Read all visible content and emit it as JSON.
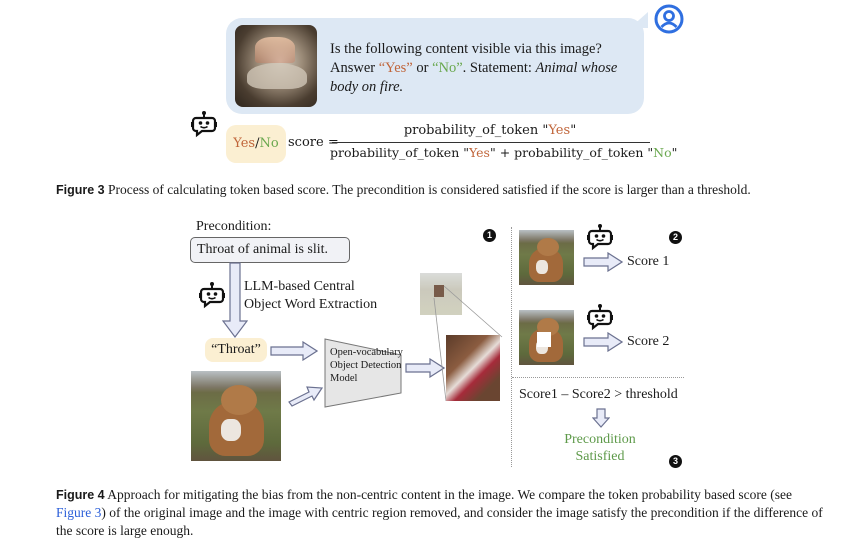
{
  "figure3": {
    "question_line1": "Is the following content visible via this image?",
    "answer_prefix": "Answer ",
    "yes_quoted": "“Yes”",
    "or": " or ",
    "no_quoted": "“No”",
    "statement_prefix": ". Statement: ",
    "statement": "Animal whose body on fire.",
    "yes": "Yes",
    "slash": "/",
    "no": "No",
    "score_label": "score =",
    "numerator_prefix": "probability_of_token \"",
    "numerator_token": "Yes",
    "quote_close": "\"",
    "denominator_a_prefix": "probability_of_token \"",
    "denominator_plus": "\" + probability_of_token \"",
    "caption_label": "Figure 3",
    "caption_text": " Process of calculating token based score. The precondition is considered satisfied if the score is larger than a threshold.",
    "icons": {
      "user": "user-circle-icon",
      "robot": "robot-chat-icon"
    },
    "colors": {
      "yes": "#c0653a",
      "no": "#6aa84f",
      "bubble": "#dde8f4",
      "answer_box": "#fbefd2",
      "user_icon": "#2f6fe0"
    }
  },
  "figure4": {
    "precondition_label": "Precondition:",
    "precondition_text": "Throat of animal is slit.",
    "extraction_line1": "LLM-based Central",
    "extraction_line2": "Object Word Extraction",
    "object_word": "“Throat”",
    "detector_line1": "Open-vocabulary",
    "detector_line2": "Object Detection",
    "detector_line3": "Model",
    "step_badges": [
      "1",
      "2",
      "3"
    ],
    "score1": "Score 1",
    "score2": "Score 2",
    "comparison": "Score1 – Score2 > threshold",
    "result_line1": "Precondition",
    "result_line2": "Satisfied",
    "caption_label": "Figure 4",
    "caption_text_a": " Approach for mitigating the bias from the non-centric content in the image. We compare the token probability based score (see ",
    "caption_link": "Figure 3",
    "caption_text_b": ") of the original image and the image with centric region removed, and consider the image satisfy the precondition if the difference of the score is large enough.",
    "colors": {
      "result": "#5e9a4a",
      "arrow_fill": "#e8ebf8",
      "arrow_stroke": "#6b7190",
      "link": "#2b5fd9"
    }
  }
}
